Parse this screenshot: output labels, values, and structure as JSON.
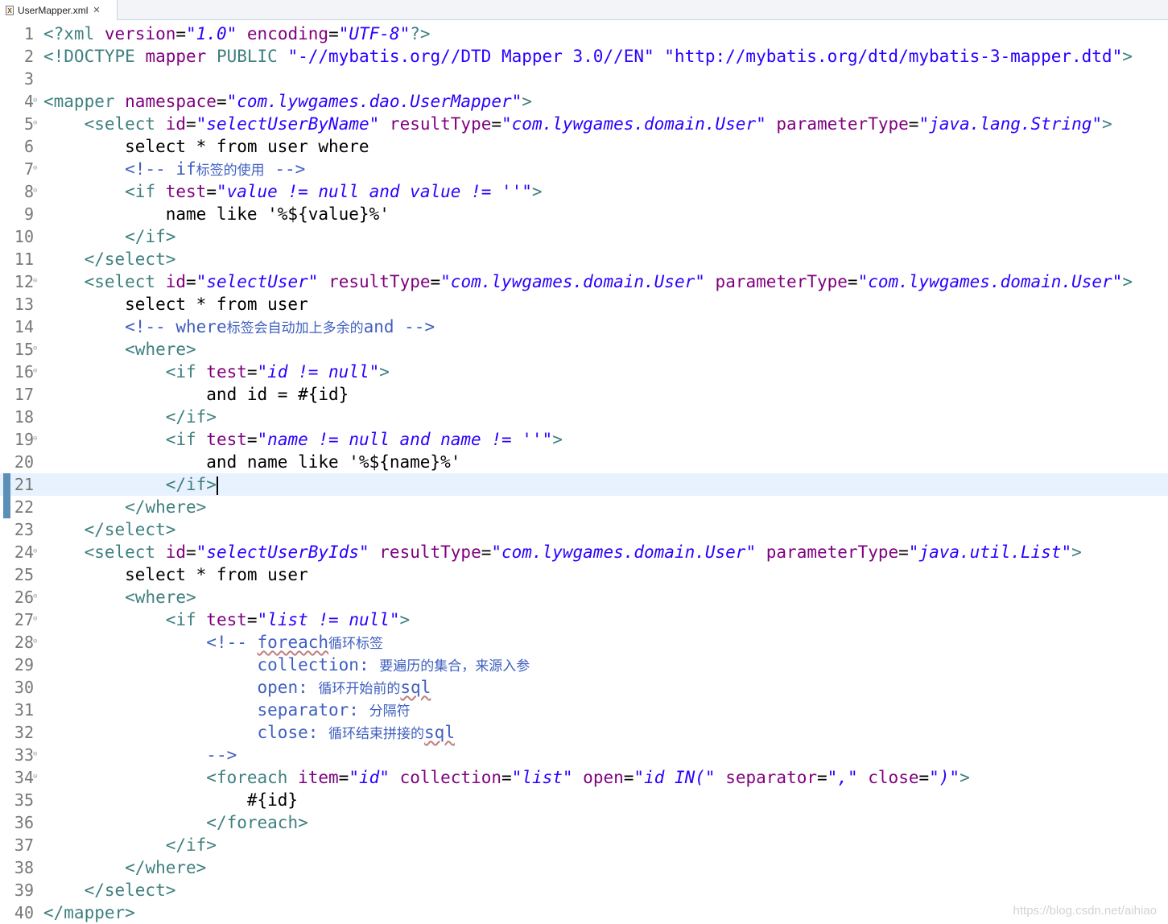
{
  "tab": {
    "title": "UserMapper.xml"
  },
  "watermark": "https://blog.csdn.net/aihiao",
  "current_line": 21,
  "lines": [
    {
      "n": "1",
      "tokens": [
        [
          "tag",
          "<?xml "
        ],
        [
          "attr",
          "version"
        ],
        [
          "plain",
          "="
        ],
        [
          "val",
          "\"1.0\""
        ],
        [
          "plain",
          " "
        ],
        [
          "attr",
          "encoding"
        ],
        [
          "plain",
          "="
        ],
        [
          "val",
          "\"UTF-8\""
        ],
        [
          "tag",
          "?>"
        ]
      ]
    },
    {
      "n": "2",
      "tokens": [
        [
          "tag",
          "<!DOCTYPE "
        ],
        [
          "attr",
          "mapper"
        ],
        [
          "plain",
          " "
        ],
        [
          "tag",
          "PUBLIC"
        ],
        [
          "plain",
          " "
        ],
        [
          "str",
          "\"-//mybatis.org//DTD Mapper 3.0//EN\""
        ],
        [
          "plain",
          " "
        ],
        [
          "str",
          "\"http://mybatis.org/dtd/mybatis-3-mapper.dtd\""
        ],
        [
          "tag",
          ">"
        ]
      ]
    },
    {
      "n": "3",
      "tokens": []
    },
    {
      "n": "4",
      "fold": true,
      "tokens": [
        [
          "tag",
          "<mapper "
        ],
        [
          "attr",
          "namespace"
        ],
        [
          "plain",
          "="
        ],
        [
          "val",
          "\"com.lywgames.dao.UserMapper\""
        ],
        [
          "tag",
          ">"
        ]
      ]
    },
    {
      "n": "5",
      "fold": true,
      "tokens": [
        [
          "plain",
          "    "
        ],
        [
          "tag",
          "<select "
        ],
        [
          "attr",
          "id"
        ],
        [
          "plain",
          "="
        ],
        [
          "val",
          "\"selectUserByName\""
        ],
        [
          "plain",
          " "
        ],
        [
          "attr",
          "resultType"
        ],
        [
          "plain",
          "="
        ],
        [
          "val",
          "\"com.lywgames.domain.User\""
        ],
        [
          "plain",
          " "
        ],
        [
          "attr",
          "parameterType"
        ],
        [
          "plain",
          "="
        ],
        [
          "val",
          "\"java.lang.String\""
        ],
        [
          "tag",
          ">"
        ]
      ]
    },
    {
      "n": "6",
      "tokens": [
        [
          "plain",
          "        select * from user where"
        ]
      ]
    },
    {
      "n": "7",
      "fold": true,
      "tokens": [
        [
          "plain",
          "        "
        ],
        [
          "comment",
          "<!-- if"
        ],
        [
          "commentcjk",
          "标签的使用"
        ],
        [
          "comment",
          " -->"
        ]
      ]
    },
    {
      "n": "8",
      "fold": true,
      "tokens": [
        [
          "plain",
          "        "
        ],
        [
          "tag",
          "<if "
        ],
        [
          "attr",
          "test"
        ],
        [
          "plain",
          "="
        ],
        [
          "val",
          "\"value != null and value != ''\""
        ],
        [
          "tag",
          ">"
        ]
      ]
    },
    {
      "n": "9",
      "tokens": [
        [
          "plain",
          "            name like '%${value}%'"
        ]
      ]
    },
    {
      "n": "10",
      "tokens": [
        [
          "plain",
          "        "
        ],
        [
          "tag",
          "</if>"
        ]
      ]
    },
    {
      "n": "11",
      "tokens": [
        [
          "plain",
          "    "
        ],
        [
          "tag",
          "</select>"
        ]
      ]
    },
    {
      "n": "12",
      "fold": true,
      "tokens": [
        [
          "plain",
          "    "
        ],
        [
          "tag",
          "<select "
        ],
        [
          "attr",
          "id"
        ],
        [
          "plain",
          "="
        ],
        [
          "val",
          "\"selectUser\""
        ],
        [
          "plain",
          " "
        ],
        [
          "attr",
          "resultType"
        ],
        [
          "plain",
          "="
        ],
        [
          "val",
          "\"com.lywgames.domain.User\""
        ],
        [
          "plain",
          " "
        ],
        [
          "attr",
          "parameterType"
        ],
        [
          "plain",
          "="
        ],
        [
          "val",
          "\"com.lywgames.domain.User\""
        ],
        [
          "tag",
          ">"
        ]
      ]
    },
    {
      "n": "13",
      "tokens": [
        [
          "plain",
          "        select * from user"
        ]
      ]
    },
    {
      "n": "14",
      "tokens": [
        [
          "plain",
          "        "
        ],
        [
          "comment",
          "<!-- where"
        ],
        [
          "commentcjk",
          "标签会自动加上多余的"
        ],
        [
          "comment",
          "and -->"
        ]
      ]
    },
    {
      "n": "15",
      "fold": true,
      "tokens": [
        [
          "plain",
          "        "
        ],
        [
          "tag",
          "<where>"
        ]
      ]
    },
    {
      "n": "16",
      "fold": true,
      "tokens": [
        [
          "plain",
          "            "
        ],
        [
          "tag",
          "<if "
        ],
        [
          "attr",
          "test"
        ],
        [
          "plain",
          "="
        ],
        [
          "val",
          "\"id != null\""
        ],
        [
          "tag",
          ">"
        ]
      ]
    },
    {
      "n": "17",
      "tokens": [
        [
          "plain",
          "                and id = #{id}"
        ]
      ]
    },
    {
      "n": "18",
      "tokens": [
        [
          "plain",
          "            "
        ],
        [
          "tag",
          "</if>"
        ]
      ]
    },
    {
      "n": "19",
      "fold": true,
      "tokens": [
        [
          "plain",
          "            "
        ],
        [
          "tag",
          "<if "
        ],
        [
          "attr",
          "test"
        ],
        [
          "plain",
          "="
        ],
        [
          "val",
          "\"name != null and name != ''\""
        ],
        [
          "tag",
          ">"
        ]
      ]
    },
    {
      "n": "20",
      "tokens": [
        [
          "plain",
          "                and name like '%${name}%'"
        ]
      ]
    },
    {
      "n": "21",
      "marker": true,
      "caret": true,
      "tokens": [
        [
          "plain",
          "            "
        ],
        [
          "tag",
          "</if>"
        ]
      ]
    },
    {
      "n": "22",
      "marker": true,
      "tokens": [
        [
          "plain",
          "        "
        ],
        [
          "tag",
          "</where>"
        ]
      ]
    },
    {
      "n": "23",
      "tokens": [
        [
          "plain",
          "    "
        ],
        [
          "tag",
          "</select>"
        ]
      ]
    },
    {
      "n": "24",
      "fold": true,
      "tokens": [
        [
          "plain",
          "    "
        ],
        [
          "tag",
          "<select "
        ],
        [
          "attr",
          "id"
        ],
        [
          "plain",
          "="
        ],
        [
          "val",
          "\"selectUserByIds\""
        ],
        [
          "plain",
          " "
        ],
        [
          "attr",
          "resultType"
        ],
        [
          "plain",
          "="
        ],
        [
          "val",
          "\"com.lywgames.domain.User\""
        ],
        [
          "plain",
          " "
        ],
        [
          "attr",
          "parameterType"
        ],
        [
          "plain",
          "="
        ],
        [
          "val",
          "\"java.util.List\""
        ],
        [
          "tag",
          ">"
        ]
      ]
    },
    {
      "n": "25",
      "tokens": [
        [
          "plain",
          "        select * from user"
        ]
      ]
    },
    {
      "n": "26",
      "fold": true,
      "tokens": [
        [
          "plain",
          "        "
        ],
        [
          "tag",
          "<where>"
        ]
      ]
    },
    {
      "n": "27",
      "fold": true,
      "tokens": [
        [
          "plain",
          "            "
        ],
        [
          "tag",
          "<if "
        ],
        [
          "attr",
          "test"
        ],
        [
          "plain",
          "="
        ],
        [
          "val",
          "\"list != null\""
        ],
        [
          "tag",
          ">"
        ]
      ]
    },
    {
      "n": "28",
      "fold": true,
      "tokens": [
        [
          "plain",
          "                "
        ],
        [
          "comment",
          "<!-- "
        ],
        [
          "commentsq",
          "foreach"
        ],
        [
          "commentcjk",
          "循环标签"
        ]
      ]
    },
    {
      "n": "29",
      "tokens": [
        [
          "plain",
          "                     "
        ],
        [
          "comment",
          "collection: "
        ],
        [
          "commentcjk",
          "要遍历的集合，来源入参"
        ]
      ]
    },
    {
      "n": "30",
      "tokens": [
        [
          "plain",
          "                     "
        ],
        [
          "comment",
          "open: "
        ],
        [
          "commentcjk",
          "循环开始前的"
        ],
        [
          "commentsq",
          "sql"
        ]
      ]
    },
    {
      "n": "31",
      "tokens": [
        [
          "plain",
          "                     "
        ],
        [
          "comment",
          "separator: "
        ],
        [
          "commentcjk",
          "分隔符"
        ]
      ]
    },
    {
      "n": "32",
      "tokens": [
        [
          "plain",
          "                     "
        ],
        [
          "comment",
          "close: "
        ],
        [
          "commentcjk",
          "循环结束拼接的"
        ],
        [
          "commentsq",
          "sql"
        ]
      ]
    },
    {
      "n": "33",
      "fold": true,
      "tokens": [
        [
          "plain",
          "                "
        ],
        [
          "comment",
          "-->"
        ]
      ]
    },
    {
      "n": "34",
      "fold": true,
      "tokens": [
        [
          "plain",
          "                "
        ],
        [
          "tag",
          "<foreach "
        ],
        [
          "attr",
          "item"
        ],
        [
          "plain",
          "="
        ],
        [
          "val",
          "\"id\""
        ],
        [
          "plain",
          " "
        ],
        [
          "attr",
          "collection"
        ],
        [
          "plain",
          "="
        ],
        [
          "val",
          "\"list\""
        ],
        [
          "plain",
          " "
        ],
        [
          "attr",
          "open"
        ],
        [
          "plain",
          "="
        ],
        [
          "val",
          "\"id IN(\""
        ],
        [
          "plain",
          " "
        ],
        [
          "attr",
          "separator"
        ],
        [
          "plain",
          "="
        ],
        [
          "val",
          "\",\""
        ],
        [
          "plain",
          " "
        ],
        [
          "attr",
          "close"
        ],
        [
          "plain",
          "="
        ],
        [
          "val",
          "\")\""
        ],
        [
          "tag",
          ">"
        ]
      ]
    },
    {
      "n": "35",
      "tokens": [
        [
          "plain",
          "                    #{id}"
        ]
      ]
    },
    {
      "n": "36",
      "tokens": [
        [
          "plain",
          "                "
        ],
        [
          "tag",
          "</foreach>"
        ]
      ]
    },
    {
      "n": "37",
      "tokens": [
        [
          "plain",
          "            "
        ],
        [
          "tag",
          "</if>"
        ]
      ]
    },
    {
      "n": "38",
      "tokens": [
        [
          "plain",
          "        "
        ],
        [
          "tag",
          "</where>"
        ]
      ]
    },
    {
      "n": "39",
      "tokens": [
        [
          "plain",
          "    "
        ],
        [
          "tag",
          "</select>"
        ]
      ]
    },
    {
      "n": "40",
      "tokens": [
        [
          "tag",
          "</mapper>"
        ]
      ]
    }
  ]
}
